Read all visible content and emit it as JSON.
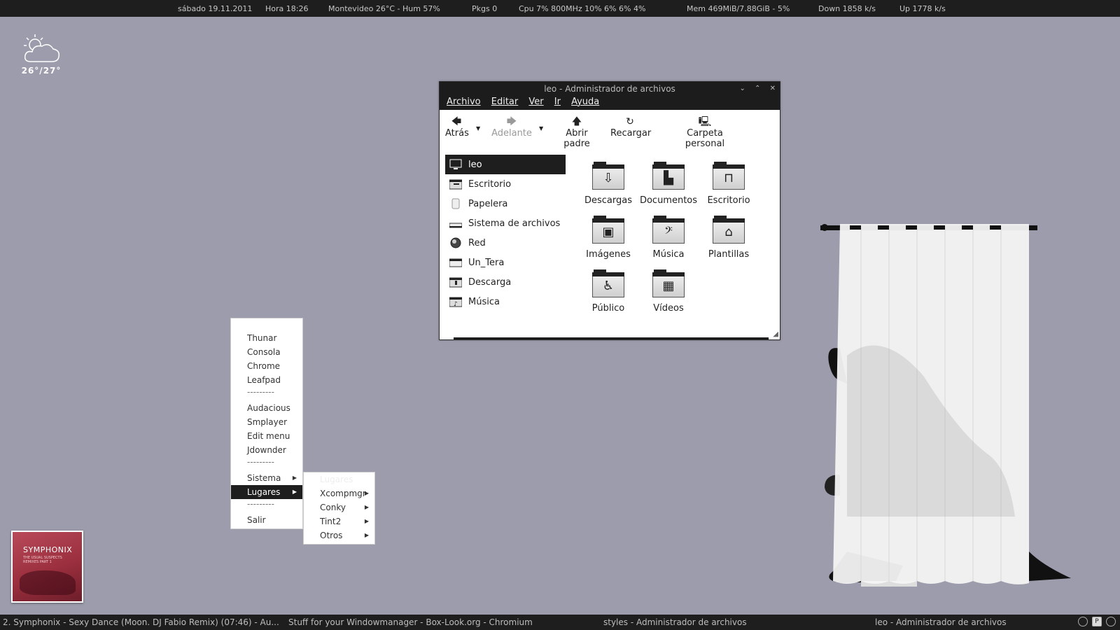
{
  "topbar": {
    "date": "sábado 19.11.2011",
    "time": "Hora 18:26",
    "weather": "Montevideo  26°C -  Hum 57%",
    "pkgs": "Pkgs 0",
    "cpu": "Cpu 7%  800MHz  10% 6% 6%  4%",
    "mem": "Mem 469MiB/7.88GiB - 5%",
    "down": "Down 1858  k/s",
    "up": "Up 1778  k/s"
  },
  "weather_widget": {
    "temp": "26°/27°",
    "icon": "partly-cloudy-icon"
  },
  "file_manager": {
    "title": "leo - Administrador de archivos",
    "menu": [
      "Archivo",
      "Editar",
      "Ver",
      "Ir",
      "Ayuda"
    ],
    "toolbar": {
      "back": "Atrás",
      "forward": "Adelante",
      "parent": "Abrir padre",
      "reload": "Recargar",
      "home": "Carpeta personal"
    },
    "sidebar": [
      {
        "label": "leo",
        "icon": "monitor-icon"
      },
      {
        "label": "Escritorio",
        "icon": "desktop-folder-icon"
      },
      {
        "label": "Papelera",
        "icon": "trash-icon"
      },
      {
        "label": "Sistema de archivos",
        "icon": "drive-icon"
      },
      {
        "label": "Red",
        "icon": "network-icon"
      },
      {
        "label": "Un_Tera",
        "icon": "drive-icon"
      },
      {
        "label": "Descarga",
        "icon": "download-folder-icon"
      },
      {
        "label": "Música",
        "icon": "music-folder-icon"
      }
    ],
    "folders": [
      {
        "label": "Descargas",
        "glyph": "⇩"
      },
      {
        "label": "Documentos",
        "glyph": "▙"
      },
      {
        "label": "Escritorio",
        "glyph": "⊓"
      },
      {
        "label": "Imágenes",
        "glyph": "▣"
      },
      {
        "label": "Música",
        "glyph": "𝄢"
      },
      {
        "label": "Plantillas",
        "glyph": "⌂"
      },
      {
        "label": "Público",
        "glyph": "♿"
      },
      {
        "label": "Vídeos",
        "glyph": "▦"
      }
    ]
  },
  "main_menu": {
    "items": [
      "Thunar",
      "Consola",
      "Chrome",
      "Leafpad",
      "---------",
      "Audacious",
      "Smplayer",
      "Edit menu",
      "Jdownder",
      "---------",
      "Sistema",
      "Lugares",
      "---------",
      "Salir"
    ]
  },
  "sub_menu": {
    "items": [
      "Lugares",
      "Xcompmgr",
      "Conky",
      "Tint2",
      "Otros"
    ]
  },
  "album": {
    "artist": "SYMPHONIX",
    "subtitle": "THE USUAL SUSPECTS REMIXES PART 1"
  },
  "taskbar": {
    "tasks": [
      "2. Symphonix - Sexy Dance (Moon. DJ Fabio Remix) (07:46) - Au...",
      "Stuff for your Windowmanager - Box-Look.org - Chromium",
      "styles - Administrador de archivos",
      "leo - Administrador de archivos"
    ]
  }
}
